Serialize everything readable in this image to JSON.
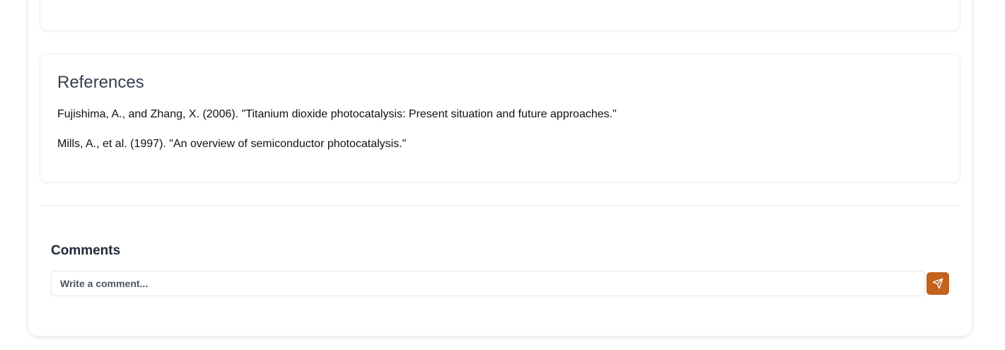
{
  "references": {
    "title": "References",
    "items": [
      "Fujishima, A., and Zhang, X. (2006). \"Titanium dioxide photocatalysis: Present situation and future approaches.\"",
      "Mills, A., et al. (1997). \"An overview of semiconductor photocatalysis.\""
    ]
  },
  "comments": {
    "title": "Comments",
    "input_placeholder": "Write a comment...",
    "input_value": "",
    "send_icon": "send-icon"
  },
  "colors": {
    "accent": "#c2621f"
  }
}
